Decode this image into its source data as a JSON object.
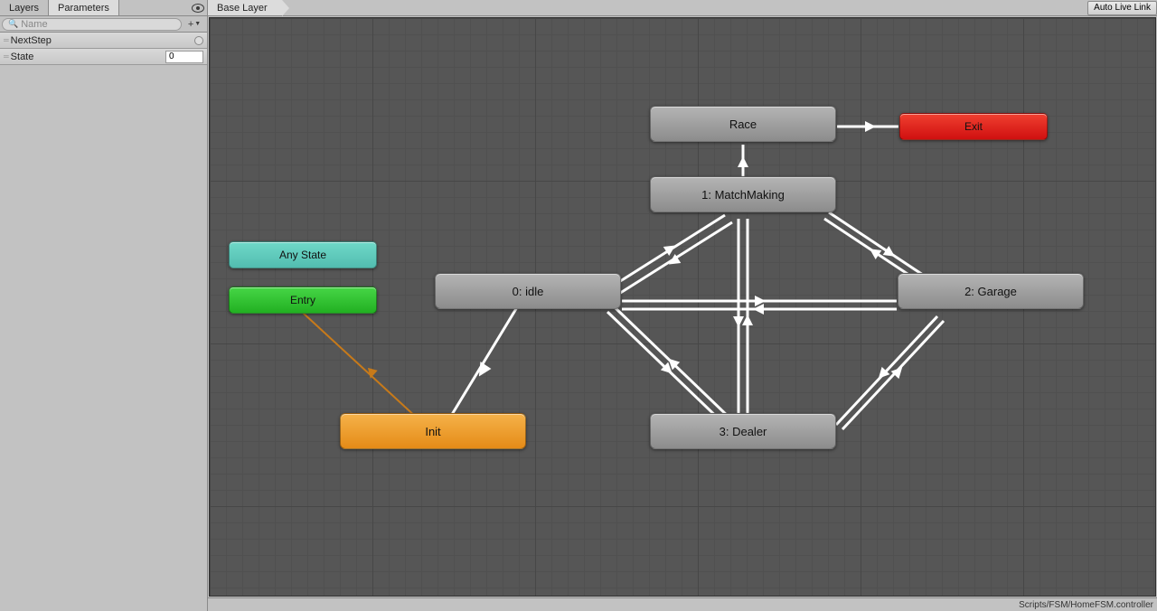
{
  "tabs": {
    "layers": "Layers",
    "parameters": "Parameters"
  },
  "search": {
    "placeholder": "Name"
  },
  "parameters": [
    {
      "name": "NextStep",
      "type": "bool"
    },
    {
      "name": "State",
      "type": "int",
      "value": "0"
    }
  ],
  "breadcrumb": {
    "item0": "Base Layer"
  },
  "toolbar": {
    "auto_live_link": "Auto Live Link"
  },
  "nodes": {
    "any_state": "Any State",
    "entry": "Entry",
    "init": "Init",
    "idle": "0: idle",
    "matchmaking": "1: MatchMaking",
    "garage": "2: Garage",
    "dealer": "3: Dealer",
    "race": "Race",
    "exit": "Exit"
  },
  "status": {
    "path": "Scripts/FSM/HomeFSM.controller"
  }
}
